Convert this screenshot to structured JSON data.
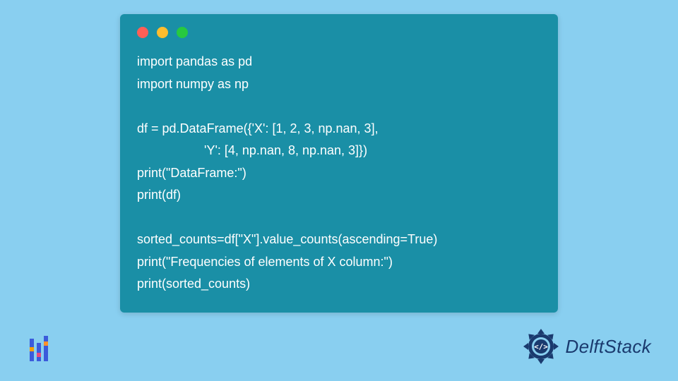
{
  "code": {
    "lines": [
      "import pandas as pd",
      "import numpy as np",
      "",
      "df = pd.DataFrame({'X': [1, 2, 3, np.nan, 3],",
      "                   'Y': [4, np.nan, 8, np.nan, 3]})",
      "print(\"DataFrame:\")",
      "print(df)",
      "",
      "sorted_counts=df[\"X\"].value_counts(ascending=True)",
      "print(\"Frequencies of elements of X column:\")",
      "print(sorted_counts)"
    ]
  },
  "brand": {
    "name": "DelftStack"
  },
  "window": {
    "dot_red": "close",
    "dot_yellow": "minimize",
    "dot_green": "zoom"
  }
}
